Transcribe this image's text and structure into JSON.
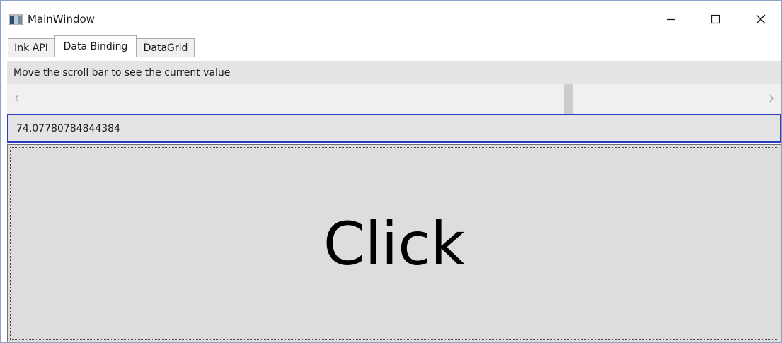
{
  "window": {
    "title": "MainWindow",
    "icons": {
      "app": "app-icon",
      "minimize": "minimize-icon",
      "maximize": "maximize-icon",
      "close": "close-icon"
    }
  },
  "tabs": [
    {
      "label": "Ink API",
      "selected": false
    },
    {
      "label": "Data Binding",
      "selected": true
    },
    {
      "label": "DataGrid",
      "selected": false
    }
  ],
  "content": {
    "instruction": "Move the scroll bar to see the current value",
    "scrollbar": {
      "position_fraction": 0.74,
      "left_arrow_icon": "chevron-left-icon",
      "right_arrow_icon": "chevron-right-icon"
    },
    "value_text": "74.07780784844384",
    "button_label": "Click"
  },
  "colors": {
    "focus_border": "#2a3cbf",
    "control_background": "#e4e4e4",
    "button_background": "#dddddd"
  }
}
